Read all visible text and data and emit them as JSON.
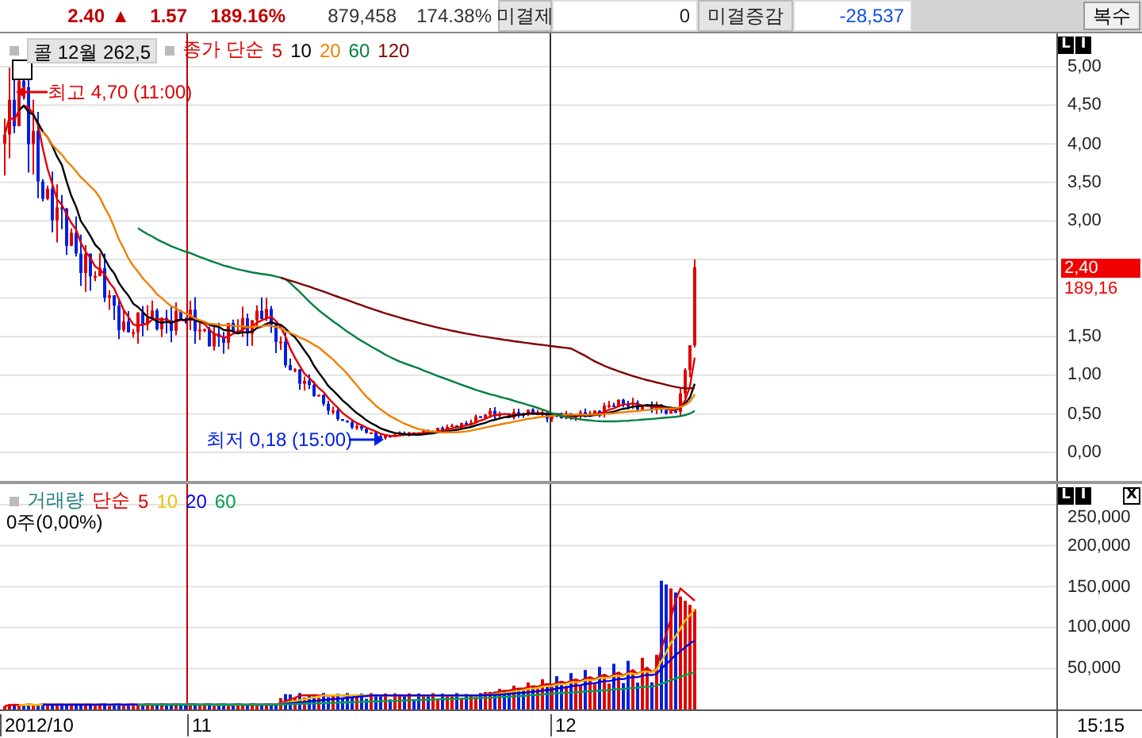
{
  "header": {
    "price": "2.40",
    "direction": "▲",
    "change": "1.57",
    "change_rate": "189.16%",
    "volume": "879,458",
    "volume_ratio": "174.38%",
    "button": "복수",
    "fields": [
      {
        "label": "미결제",
        "value": "0",
        "kind": "plain"
      },
      {
        "label": "미결증감",
        "value": "-28,537",
        "kind": "negative"
      }
    ]
  },
  "price_panel": {
    "symbol_button": "콜 12월 262,5",
    "legend_label": "종가 단순",
    "averages": [
      {
        "period": "5",
        "color": "#e00000"
      },
      {
        "period": "10",
        "color": "#000000"
      },
      {
        "period": "20",
        "color": "#f08000"
      },
      {
        "period": "60",
        "color": "#008040"
      },
      {
        "period": "120",
        "color": "#800000"
      }
    ],
    "high_note": "최고 4,70 (11:00)",
    "low_note": "최저 0,18 (15:00)",
    "axis_buttons": [
      "L",
      "I"
    ],
    "yticks": [
      "5,00",
      "4,50",
      "4,00",
      "3,50",
      "3,00",
      "1,50",
      "1,00",
      "0,50",
      "0,00"
    ],
    "last_price": "2,40",
    "last_rate": "189,16"
  },
  "volume_panel": {
    "title": "거래량",
    "legend_label": "단순",
    "averages": [
      {
        "period": "5",
        "color": "#e00000"
      },
      {
        "period": "10",
        "color": "#f0c000"
      },
      {
        "period": "20",
        "color": "#0000e0"
      },
      {
        "period": "60",
        "color": "#00a050"
      }
    ],
    "info": "0주(0,00%)",
    "axis_buttons": [
      "L",
      "I"
    ],
    "close": "X",
    "yticks": [
      "250,000",
      "200,000",
      "150,000",
      "100,000",
      "50,000"
    ]
  },
  "x_axis": {
    "labels": [
      "2012/10",
      "11",
      "12"
    ],
    "time": "15:15"
  }
}
